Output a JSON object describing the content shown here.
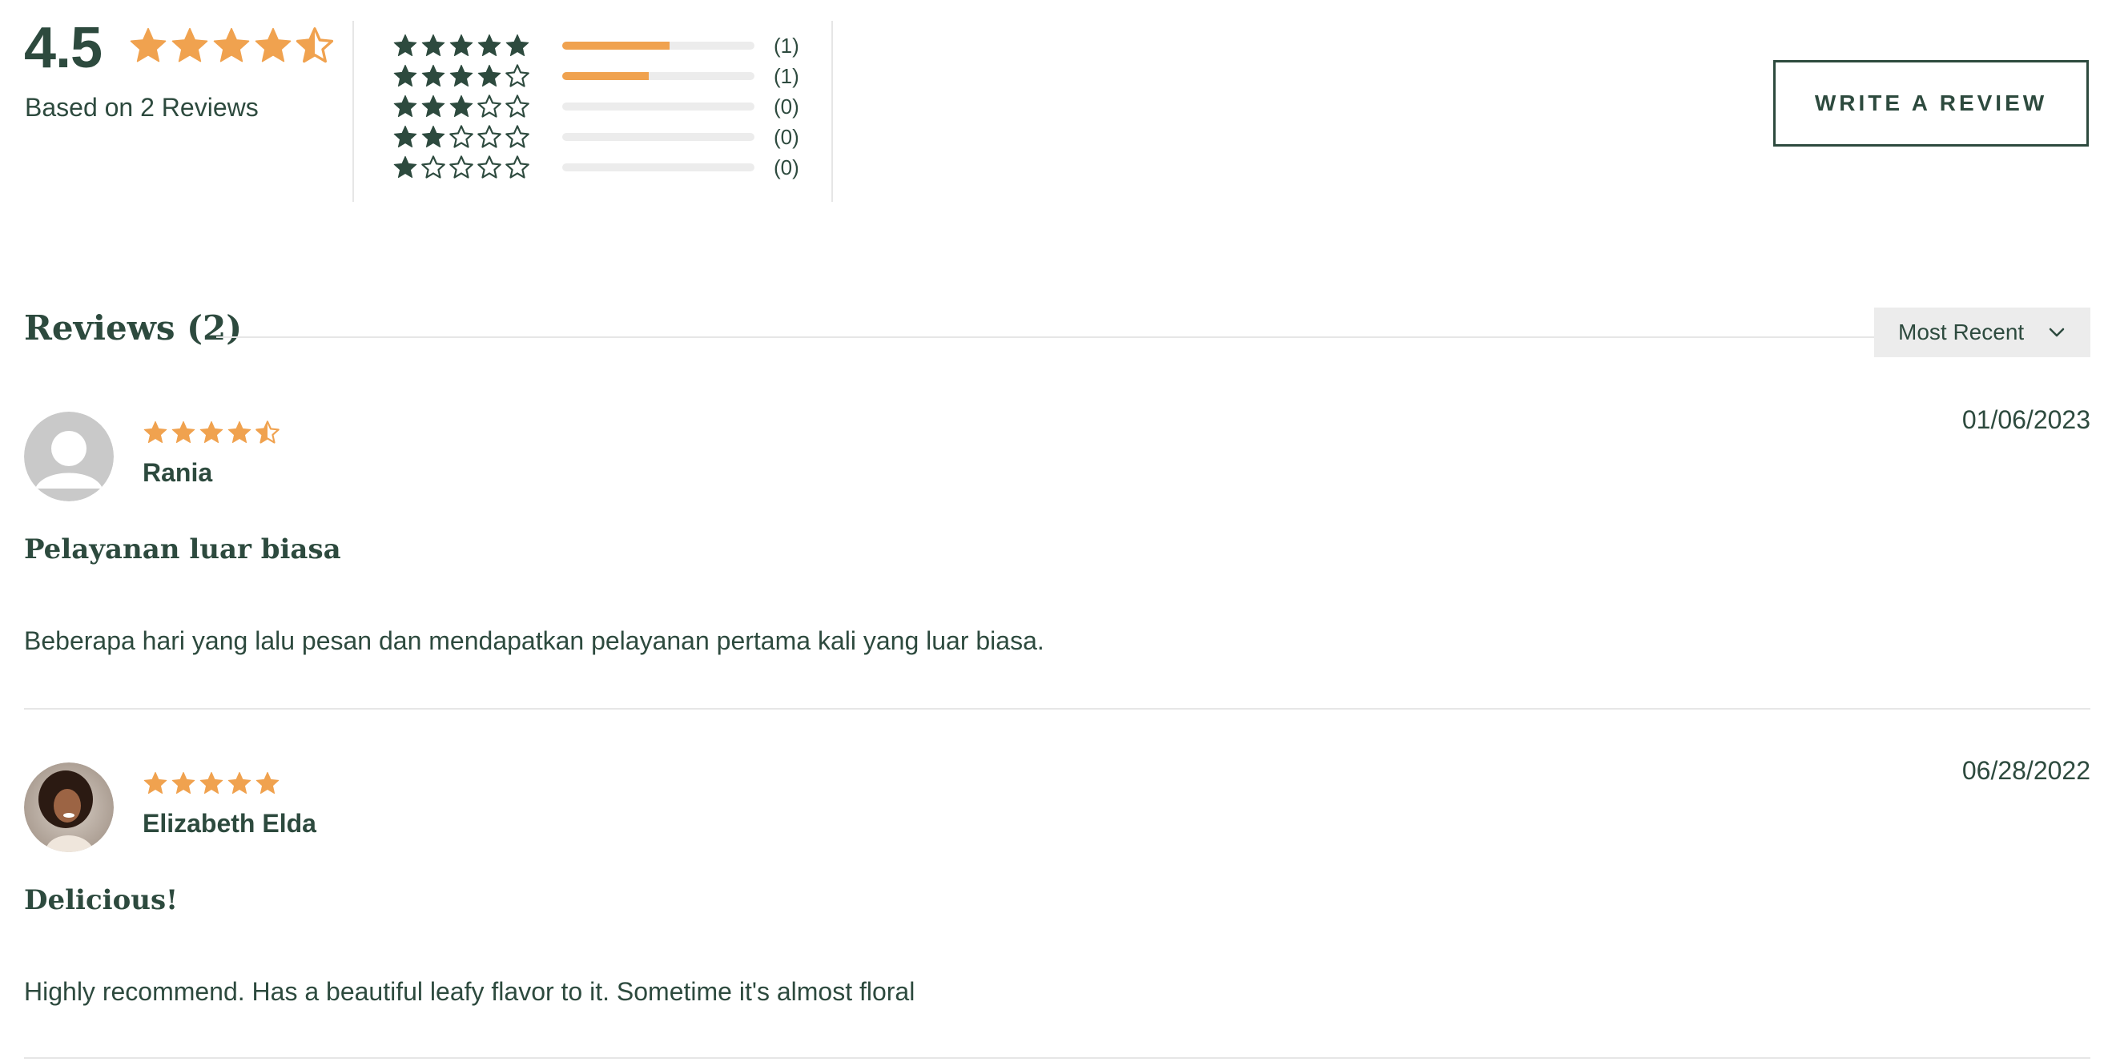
{
  "colors": {
    "accent": "#f0a24f",
    "brand": "#2d4a3e",
    "divider": "#e6e6e6"
  },
  "summary": {
    "average": "4.5",
    "average_value": 4.5,
    "based_on": "Based on 2 Reviews",
    "write_review_label": "WRITE A REVIEW"
  },
  "histogram": [
    {
      "stars": 5,
      "fraction": 0.56,
      "count": "(1)"
    },
    {
      "stars": 4,
      "fraction": 0.45,
      "count": "(1)"
    },
    {
      "stars": 3,
      "fraction": 0,
      "count": "(0)"
    },
    {
      "stars": 2,
      "fraction": 0,
      "count": "(0)"
    },
    {
      "stars": 1,
      "fraction": 0,
      "count": "(0)"
    }
  ],
  "reviews_header": {
    "title": "Reviews (2)",
    "sort_selected": "Most Recent",
    "sort_icon": "chevron-down-icon"
  },
  "reviews": [
    {
      "rating": 4.5,
      "author": "Rania",
      "date": "01/06/2023",
      "title": "Pelayanan luar biasa",
      "body": "Beberapa hari yang lalu pesan dan mendapatkan pelayanan pertama kali yang luar biasa.",
      "avatar": "default-avatar-icon"
    },
    {
      "rating": 5,
      "author": "Elizabeth Elda",
      "date": "06/28/2022",
      "title": "Delicious!",
      "body": "Highly recommend. Has a beautiful leafy flavor to it. Sometime it's almost floral",
      "avatar": "user-photo"
    }
  ]
}
